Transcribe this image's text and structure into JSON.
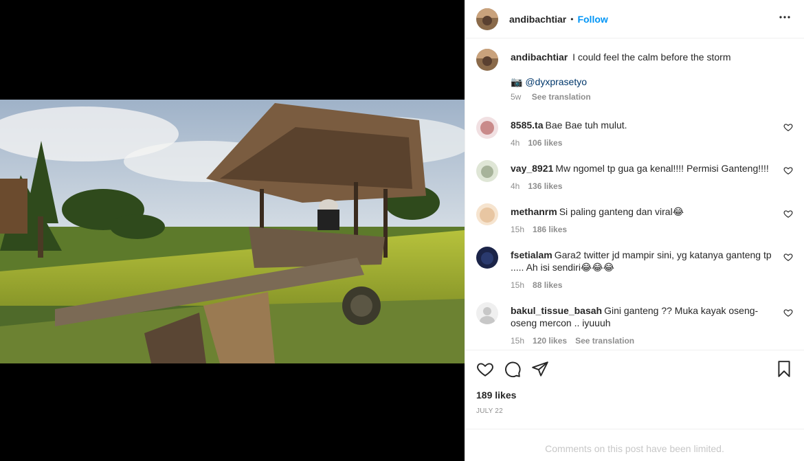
{
  "post": {
    "author": "andibachtiar",
    "follow_label": "Follow",
    "separator": "•",
    "more_icon": "more-horizontal-icon",
    "caption": "I could feel the calm before the storm",
    "camera_emoji": "📷",
    "credit": "@dyxprasetyo",
    "caption_age": "5w",
    "see_translation": "See translation",
    "likes": "189 likes",
    "date": "JULY 22",
    "comments_limited": "Comments on this post have been limited."
  },
  "comments": [
    {
      "user": "8585.ta",
      "text": "Bae Bae tuh mulut.",
      "age": "4h",
      "likes": "106 likes",
      "avatar_color": "#c98a8a"
    },
    {
      "user": "vay_8921",
      "text": "Mw ngomel tp gua ga kenal!!!! Permisi Ganteng!!!!",
      "age": "4h",
      "likes": "136 likes",
      "avatar_color": "#a7b39a"
    },
    {
      "user": "methanrm",
      "text": "Si paling ganteng dan viral😂",
      "age": "15h",
      "likes": "186 likes",
      "avatar_color": "#e8c6a2"
    },
    {
      "user": "fsetialam",
      "text": "Gara2 twitter jd mampir sini, yg katanya ganteng tp ..... Ah isi sendiri😂😂😂",
      "age": "15h",
      "likes": "88 likes",
      "avatar_color": "#2a3a6e"
    },
    {
      "user": "bakul_tissue_basah",
      "text": "Gini ganteng ?? Muka kayak oseng-oseng mercon .. iyuuuh",
      "age": "15h",
      "likes": "120 likes",
      "see_translation": "See translation",
      "avatar_color": "#dbdbdb"
    }
  ],
  "colors": {
    "accent": "#0095f6",
    "text": "#262626",
    "muted": "#8e8e8e"
  }
}
